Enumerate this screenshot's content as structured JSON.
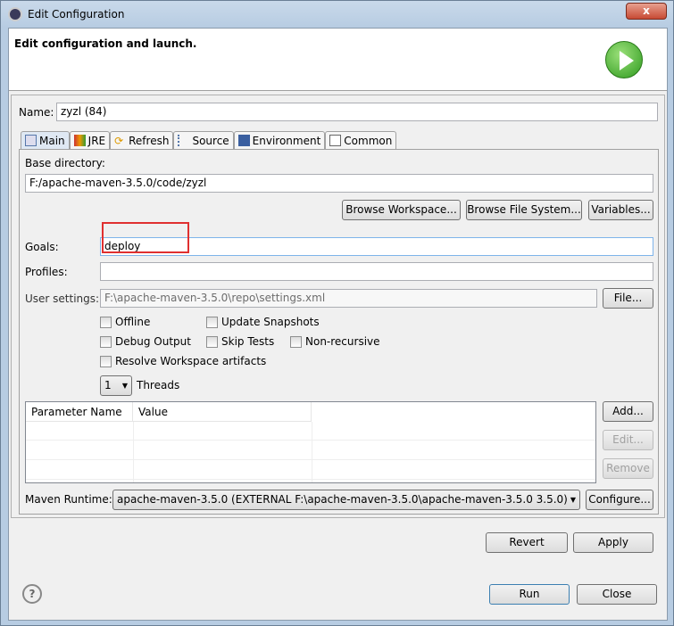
{
  "window": {
    "title": "Edit Configuration",
    "close_label": "x"
  },
  "header": {
    "title": "Edit configuration and launch."
  },
  "name": {
    "label": "Name:",
    "value": "zyzl (84)"
  },
  "tabs": [
    {
      "label": "Main",
      "icon": "main-tab-icon"
    },
    {
      "label": "JRE",
      "icon": "jre-icon"
    },
    {
      "label": "Refresh",
      "icon": "refresh-icon"
    },
    {
      "label": "Source",
      "icon": "source-icon"
    },
    {
      "label": "Environment",
      "icon": "environment-icon"
    },
    {
      "label": "Common",
      "icon": "common-icon"
    }
  ],
  "main": {
    "base_dir_label": "Base directory:",
    "base_dir_value": "F:/apache-maven-3.5.0/code/zyzl",
    "browse_workspace": "Browse Workspace...",
    "browse_fs": "Browse File System...",
    "variables": "Variables...",
    "goals_label": "Goals:",
    "goals_value": "deploy",
    "profiles_label": "Profiles:",
    "profiles_value": "",
    "user_settings_label": "User settings:",
    "user_settings_value": "F:\\apache-maven-3.5.0\\repo\\settings.xml",
    "file_button": "File...",
    "checkboxes": {
      "offline": "Offline",
      "update_snapshots": "Update Snapshots",
      "debug_output": "Debug Output",
      "skip_tests": "Skip Tests",
      "non_recursive": "Non-recursive",
      "resolve_workspace": "Resolve Workspace artifacts"
    },
    "threads_value": "1",
    "threads_label": "Threads",
    "params_columns": [
      "Parameter Name",
      "Value"
    ],
    "add": "Add...",
    "edit": "Edit...",
    "remove": "Remove",
    "runtime_label": "Maven Runtime:",
    "runtime_value": "apache-maven-3.5.0 (EXTERNAL F:\\apache-maven-3.5.0\\apache-maven-3.5.0 3.5.0)",
    "configure": "Configure..."
  },
  "footer": {
    "revert": "Revert",
    "apply": "Apply",
    "run": "Run",
    "close": "Close",
    "help_icon": "?"
  },
  "colors": {
    "highlight": "#e03030",
    "run_green": "#2e9a1e"
  }
}
